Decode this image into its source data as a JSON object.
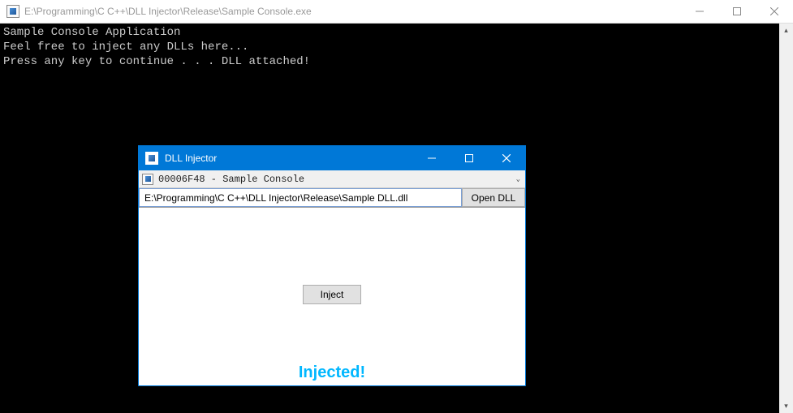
{
  "console": {
    "title": "E:\\Programming\\C C++\\DLL Injector\\Release\\Sample Console.exe",
    "lines": [
      "Sample Console Application",
      "Feel free to inject any DLLs here...",
      "Press any key to continue . . . DLL attached!"
    ]
  },
  "injector": {
    "title": "DLL Injector",
    "process_label": "00006F48 - Sample Console",
    "dll_path": "E:\\Programming\\C C++\\DLL Injector\\Release\\Sample DLL.dll",
    "open_button": "Open DLL",
    "inject_button": "Inject",
    "status": "Injected!"
  }
}
